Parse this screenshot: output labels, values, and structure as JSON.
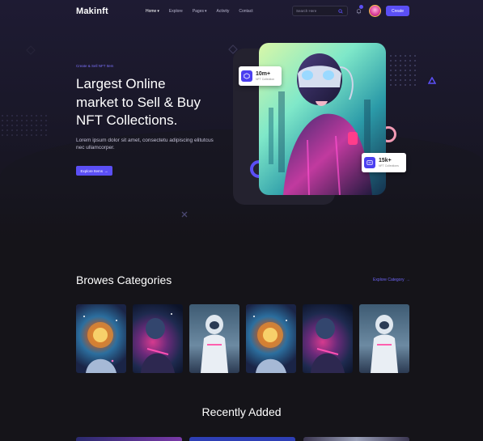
{
  "brand": {
    "logo": "Makinft",
    "accent": "#5b4ff5"
  },
  "nav": {
    "items": [
      {
        "label": "Home",
        "caret": true,
        "active": true
      },
      {
        "label": "Explore",
        "caret": false,
        "active": false
      },
      {
        "label": "Pages",
        "caret": true,
        "active": false
      },
      {
        "label": "Activity",
        "caret": false,
        "active": false
      },
      {
        "label": "Contact",
        "caret": false,
        "active": false
      }
    ],
    "search_placeholder": "Search Here",
    "create_label": "Create",
    "icons": [
      "search-icon",
      "bell-icon",
      "avatar"
    ]
  },
  "hero": {
    "eyebrow": "Create & Sell NFT Item",
    "headline": [
      "Largest Online",
      "market to Sell & Buy",
      "NFT Collections."
    ],
    "description": "Lorem ipsum dolor sit amet, consectetu adipiscing elitutcus nec ullamcorper.",
    "cta_label": "Explore Items",
    "cta_arrow": "→",
    "stats": [
      {
        "value": "10m+",
        "label": "NFT Collection",
        "icon": "cube-icon"
      },
      {
        "value": "15k+",
        "label": "NFT Collections",
        "icon": "card-icon"
      }
    ]
  },
  "categories": {
    "title": "Browes Categories",
    "link_label": "Explore Category",
    "link_arrow": "→",
    "tiles": [
      {
        "icon": "astronaut-golden-image"
      },
      {
        "icon": "astronaut-dark-image"
      },
      {
        "icon": "astronaut-silver-image"
      },
      {
        "icon": "astronaut-golden-image"
      },
      {
        "icon": "astronaut-dark-image"
      },
      {
        "icon": "astronaut-silver-image"
      }
    ]
  },
  "recent": {
    "title": "Recently Added"
  }
}
